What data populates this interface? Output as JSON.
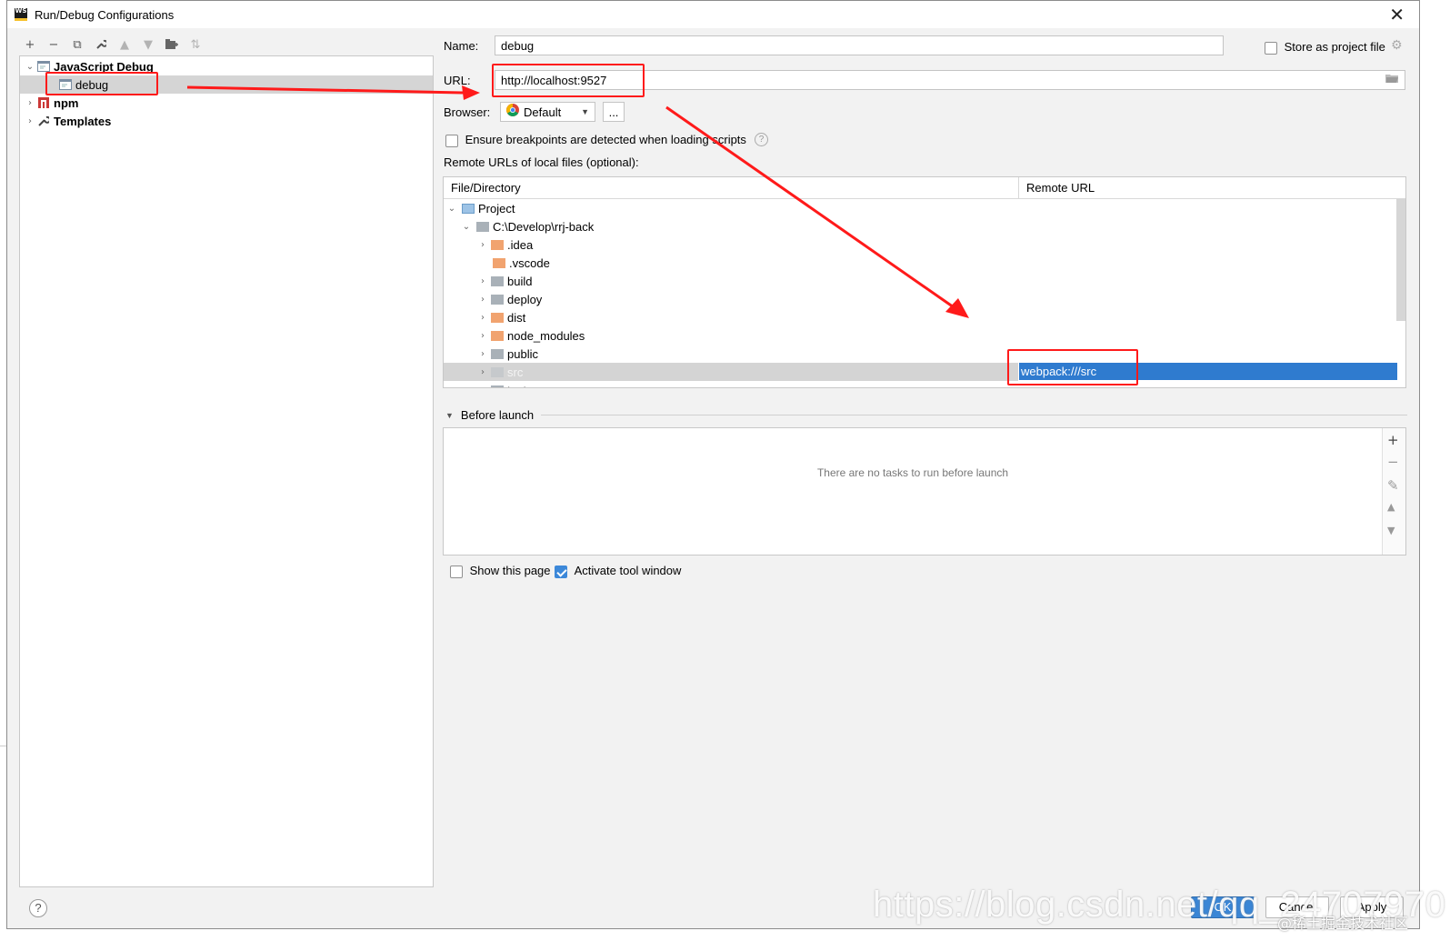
{
  "window": {
    "title": "Run/Debug Configurations",
    "app_icon": "WS",
    "close_glyph": "✕"
  },
  "toolbar": {
    "icons": [
      "add-icon",
      "remove-icon",
      "copy-icon",
      "wrench-icon",
      "move-up-icon",
      "move-down-icon",
      "folder-add-icon",
      "sort-icon"
    ],
    "glyphs": [
      "+",
      "−",
      "⧉",
      "🔧",
      "▲",
      "▼",
      "▣",
      "⇅"
    ]
  },
  "tree": {
    "items": [
      {
        "label": "JavaScript Debug",
        "icon": "js-debug-icon",
        "expanded": true
      },
      {
        "label": "debug",
        "icon": "js-debug-config-icon",
        "selected": true
      },
      {
        "label": "npm",
        "icon": "npm-icon",
        "expanded": false
      },
      {
        "label": "Templates",
        "icon": "wrench-icon",
        "expanded": false
      }
    ]
  },
  "form": {
    "name_label": "Name:",
    "name_value": "debug",
    "store_label": "Store as project file",
    "url_label": "URL:",
    "url_value": "http://localhost:9527",
    "browser_label": "Browser:",
    "browser_value": "Default",
    "browser_more": "...",
    "ensure_label": "Ensure breakpoints are detected when loading scripts",
    "remote_urls_label": "Remote URLs of local files (optional):"
  },
  "mapping_table": {
    "columns": [
      "File/Directory",
      "Remote URL"
    ],
    "rows": [
      {
        "name": "Project",
        "level": 0,
        "icon": "project-icon",
        "chevron": "down"
      },
      {
        "name": "C:\\Develop\\rrj-back",
        "level": 1,
        "icon": "folder-icon",
        "chevron": "down"
      },
      {
        "name": ".idea",
        "level": 2,
        "icon": "folder-icon",
        "chevron": "right"
      },
      {
        "name": ".vscode",
        "level": 2,
        "icon": "folder-icon",
        "chevron": ""
      },
      {
        "name": "build",
        "level": 2,
        "icon": "folder-icon",
        "chevron": "right"
      },
      {
        "name": "deploy",
        "level": 2,
        "icon": "folder-icon",
        "chevron": "right"
      },
      {
        "name": "dist",
        "level": 2,
        "icon": "folder-icon",
        "chevron": "right"
      },
      {
        "name": "node_modules",
        "level": 2,
        "icon": "folder-icon",
        "chevron": "right"
      },
      {
        "name": "public",
        "level": 2,
        "icon": "folder-icon",
        "chevron": "right"
      },
      {
        "name": "src",
        "level": 2,
        "icon": "folder-icon",
        "chevron": "right",
        "selected": true
      },
      {
        "name": "tests",
        "level": 2,
        "icon": "folder-icon",
        "chevron": "right"
      }
    ],
    "selected_remote_url": "webpack:///src"
  },
  "before_launch": {
    "title": "Before launch",
    "empty_text": "There are no tasks to run before launch",
    "side_glyphs": [
      "+",
      "−",
      "✎",
      "▲",
      "▼"
    ]
  },
  "options": {
    "show_page_label": "Show this page",
    "show_page_checked": false,
    "activate_tool_label": "Activate tool window",
    "activate_tool_checked": true
  },
  "buttons": {
    "ok": "OK",
    "cancel": "Cancel",
    "apply": "Apply",
    "help": "?"
  },
  "watermark": {
    "text": "https://blog.csdn.net/qq_24707970",
    "secondary": "@稀土掘金技术社区"
  },
  "colors": {
    "accent": "#3a86d6",
    "selection_blue": "#2f7bcf",
    "annotation_red": "#ff1a1a"
  }
}
